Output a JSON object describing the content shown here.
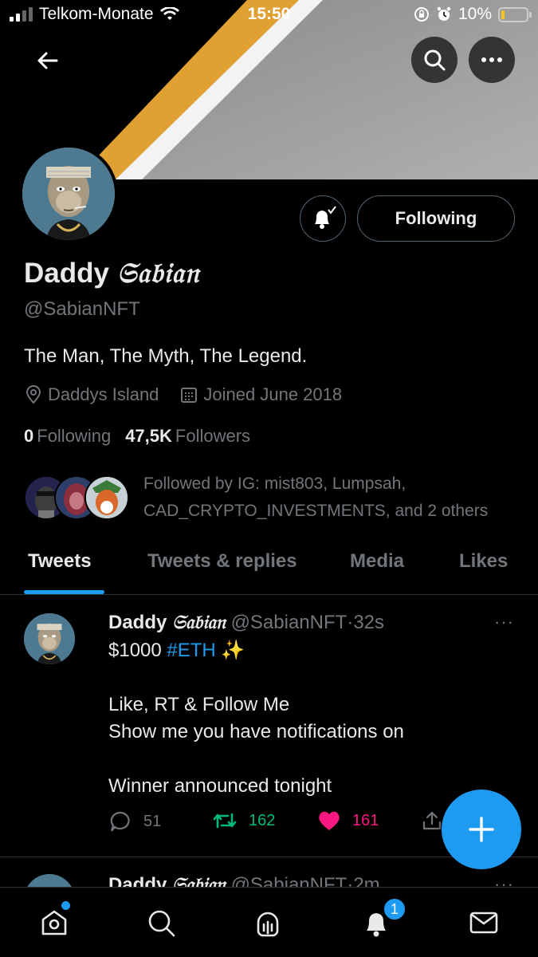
{
  "status_bar": {
    "carrier": "Telkom-Monate",
    "time": "15:50",
    "battery": "10%",
    "battery_level": 0.1
  },
  "header": {
    "back_icon": "arrow-left-icon",
    "search_icon": "search-icon",
    "more_icon": "more-horizontal-icon"
  },
  "profile": {
    "name_plain": "Daddy ",
    "name_gothic": "𝔖𝔞𝔟𝔦𝔞𝔫",
    "handle": "@SabianNFT",
    "bio": "The Man, The Myth, The Legend.",
    "location": "Daddys Island",
    "joined": "Joined June 2018",
    "following_count": "0",
    "following_label": "Following",
    "followers_count": "47,5K",
    "followers_label": "Followers",
    "follow_button": "Following",
    "followed_by": "Followed by IG: mist803, Lumpsah, CAD_CRYPTO_INVESTMENTS, and 2 others"
  },
  "tabs": [
    {
      "label": "Tweets",
      "active": true
    },
    {
      "label": "Tweets & replies",
      "active": false
    },
    {
      "label": "Media",
      "active": false
    },
    {
      "label": "Likes",
      "active": false
    }
  ],
  "tweet": {
    "name_plain": "Daddy ",
    "name_gothic": "𝔖𝔞𝔟𝔦𝔞𝔫",
    "handle": "@SabianNFT",
    "separator": "·",
    "time": "32s",
    "more": "···",
    "line1_text": "$1000 ",
    "line1_hashtag": "#ETH",
    "line1_emoji": " ✨",
    "line2": "Like, RT & Follow Me",
    "line3": "Show me you have notifications on",
    "line4": "Winner announced tonight",
    "replies": "51",
    "retweets": "162",
    "likes": "161"
  },
  "tweet2": {
    "name_plain": "Daddy ",
    "name_gothic": "𝔖𝔞𝔟𝔦𝔞𝔫",
    "handle": "@SabianNFT",
    "separator": "·",
    "time": "2m"
  },
  "bottom_nav": {
    "notification_badge": "1"
  },
  "colors": {
    "accent": "#1d9bf0",
    "retweet": "#00ba7c",
    "like": "#f91880",
    "muted": "#71767b"
  }
}
